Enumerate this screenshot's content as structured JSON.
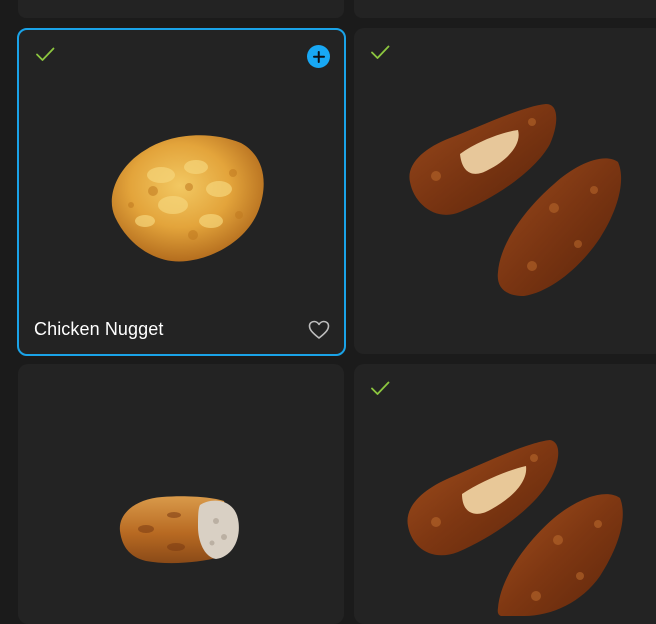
{
  "grid": {
    "items": [
      {
        "name": "Chicken Nugget",
        "checked": true,
        "selected": true,
        "show_add": true,
        "show_favorite": true,
        "image": "chicken-nugget"
      },
      {
        "name": "",
        "checked": true,
        "selected": false,
        "image": "fried-chicken-strips"
      },
      {
        "name": "",
        "checked": false,
        "selected": false,
        "image": "sausage-piece"
      },
      {
        "name": "",
        "checked": true,
        "selected": false,
        "image": "fried-chicken-strips"
      }
    ]
  },
  "colors": {
    "background": "#1b1b1b",
    "card": "#232323",
    "selection_border": "#1aa3e8",
    "check": "#8cc63f",
    "add_button": "#18a8f4"
  },
  "icons": {
    "check": "check-icon",
    "add": "plus-circle-icon",
    "favorite": "heart-outline-icon"
  }
}
